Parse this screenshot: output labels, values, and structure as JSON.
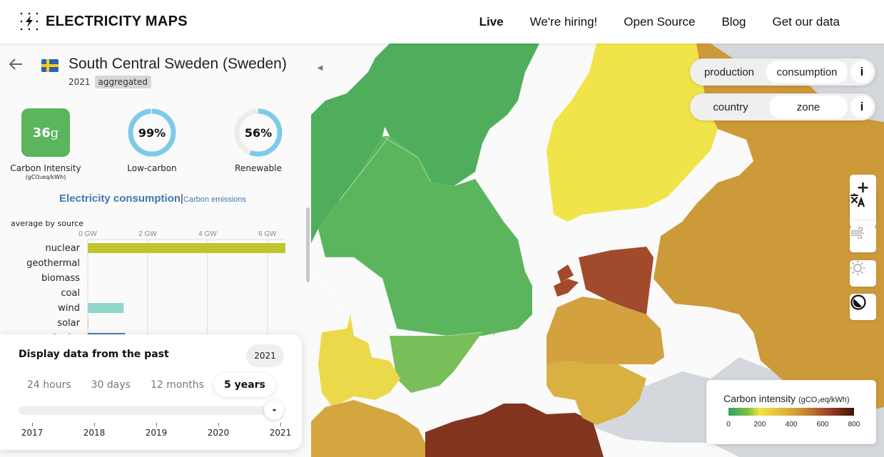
{
  "header": {
    "brand": "ELECTRICITY MAPS",
    "nav": [
      {
        "label": "Live",
        "active": true
      },
      {
        "label": "We're hiring!",
        "active": false
      },
      {
        "label": "Open Source",
        "active": false
      },
      {
        "label": "Blog",
        "active": false
      },
      {
        "label": "Get our data",
        "active": false
      }
    ]
  },
  "zone": {
    "name": "South Central Sweden (Sweden)",
    "flag": "sweden-flag",
    "year": "2021",
    "badge": "aggregated"
  },
  "metrics": {
    "carbon_intensity": {
      "value": "36",
      "unit_suffix": "g",
      "label": "Carbon Intensity",
      "unit": "(gCO₂eq/kWh)",
      "color": "#5ab55d"
    },
    "low_carbon": {
      "value": "99%",
      "fraction": 0.99,
      "label": "Low-carbon"
    },
    "renewable": {
      "value": "56%",
      "fraction": 0.56,
      "label": "Renewable"
    }
  },
  "chart_header": {
    "title": "Electricity consumption",
    "separator": "|",
    "alt": "Carbon emissions",
    "subtitle": "average by source"
  },
  "chart_data": {
    "type": "bar",
    "orientation": "horizontal",
    "title": "Electricity consumption",
    "subtitle": "average by source",
    "xlabel": "",
    "unit": "GW",
    "xlim": [
      0,
      6.6
    ],
    "ticks": [
      {
        "value": 0,
        "label": "0 GW"
      },
      {
        "value": 2,
        "label": "2 GW"
      },
      {
        "value": 4,
        "label": "4 GW"
      },
      {
        "value": 6,
        "label": "6 GW"
      }
    ],
    "grid": true,
    "categories": [
      "nuclear",
      "geothermal",
      "biomass",
      "coal",
      "wind",
      "solar",
      "hydro"
    ],
    "values": [
      6.6,
      0,
      0,
      0,
      1.2,
      0.02,
      1.25
    ],
    "colors": [
      "#c0c42f",
      "#ffffff",
      "#ffffff",
      "#ffffff",
      "#8fd7c8",
      "#f4b38c",
      "#4a7fb5"
    ]
  },
  "time_controller": {
    "title": "Display data from the past",
    "selected_year": "2021",
    "ranges": [
      {
        "label": "24 hours",
        "active": false
      },
      {
        "label": "30 days",
        "active": false
      },
      {
        "label": "12 months",
        "active": false
      },
      {
        "label": "5 years",
        "active": true
      }
    ],
    "slider_position": 1.0,
    "slider_thumb_glyph": "◂▸",
    "ticks": [
      "2017",
      "2018",
      "2019",
      "2020",
      "2021"
    ]
  },
  "map": {
    "toggles": [
      {
        "options": [
          {
            "label": "production",
            "active": false
          },
          {
            "label": "consumption",
            "active": true
          }
        ],
        "info": "i"
      },
      {
        "options": [
          {
            "label": "country",
            "active": false
          },
          {
            "label": "zone",
            "active": true
          }
        ],
        "info": "i"
      }
    ],
    "controls": {
      "zoom_in": "+",
      "zoom_out": "−",
      "buttons": [
        "language-icon",
        "wind-icon",
        "solar-icon",
        "dark-mode-icon"
      ]
    },
    "legend": {
      "title": "Carbon intensity",
      "unit": "(gCO₂eq/kWh)",
      "ticks": [
        "0",
        "200",
        "400",
        "600",
        "800"
      ]
    },
    "zone_colors": {
      "norway": "#4fae5c",
      "sweden_north": "#4fae5c",
      "sweden_central": "#5ab55d",
      "sweden_south": "#79be59",
      "finland": "#f1e44a",
      "denmark": "#ecd94a",
      "russia": "#cd9a3a",
      "estonia": "#a14b2c",
      "latvia": "#d3a23e",
      "lithuania": "#d9b143",
      "poland": "#83341f",
      "germany": "#d3a63f",
      "belarus_nodata": "#d4d8dc",
      "sea": "#fafafa"
    }
  }
}
